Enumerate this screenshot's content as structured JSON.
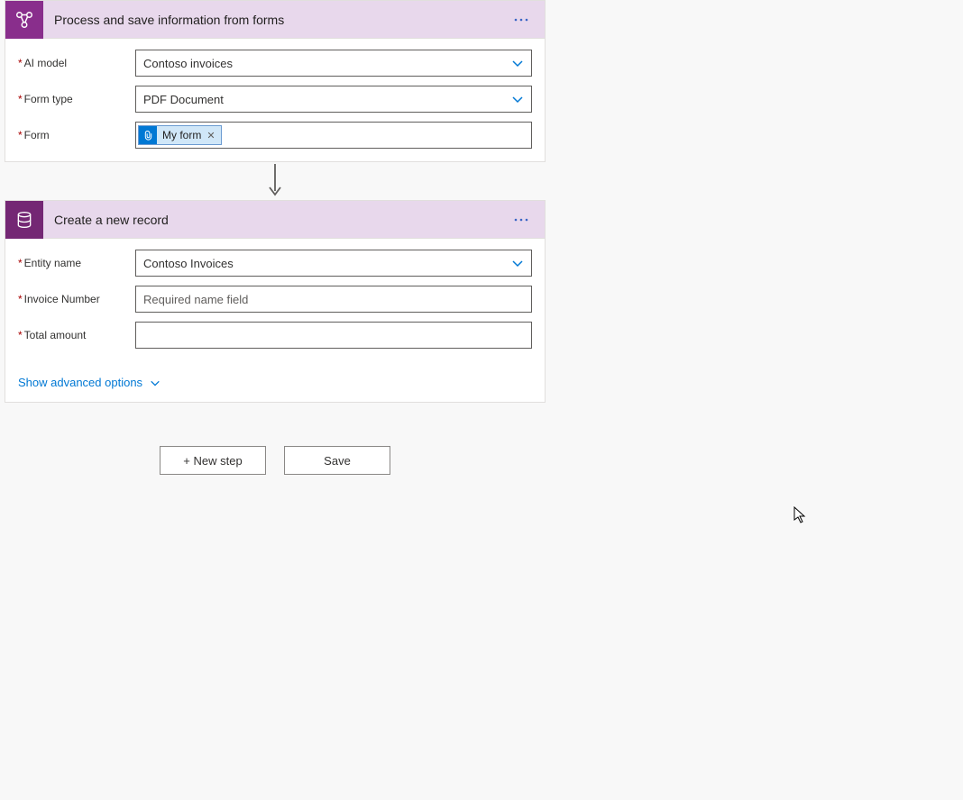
{
  "step1": {
    "title": "Process and save information from forms",
    "fields": {
      "ai_model": {
        "label": "AI model",
        "value": "Contoso invoices"
      },
      "form_type": {
        "label": "Form type",
        "value": "PDF Document"
      },
      "form": {
        "label": "Form",
        "token_label": "My form"
      }
    }
  },
  "step2": {
    "title": "Create a new record",
    "fields": {
      "entity_name": {
        "label": "Entity name",
        "value": "Contoso Invoices"
      },
      "invoice_number": {
        "label": "Invoice Number",
        "placeholder": "Required name field"
      },
      "total_amount": {
        "label": "Total amount",
        "value": ""
      }
    },
    "advanced_label": "Show advanced options"
  },
  "actions": {
    "new_step": "+ New step",
    "save": "Save"
  }
}
